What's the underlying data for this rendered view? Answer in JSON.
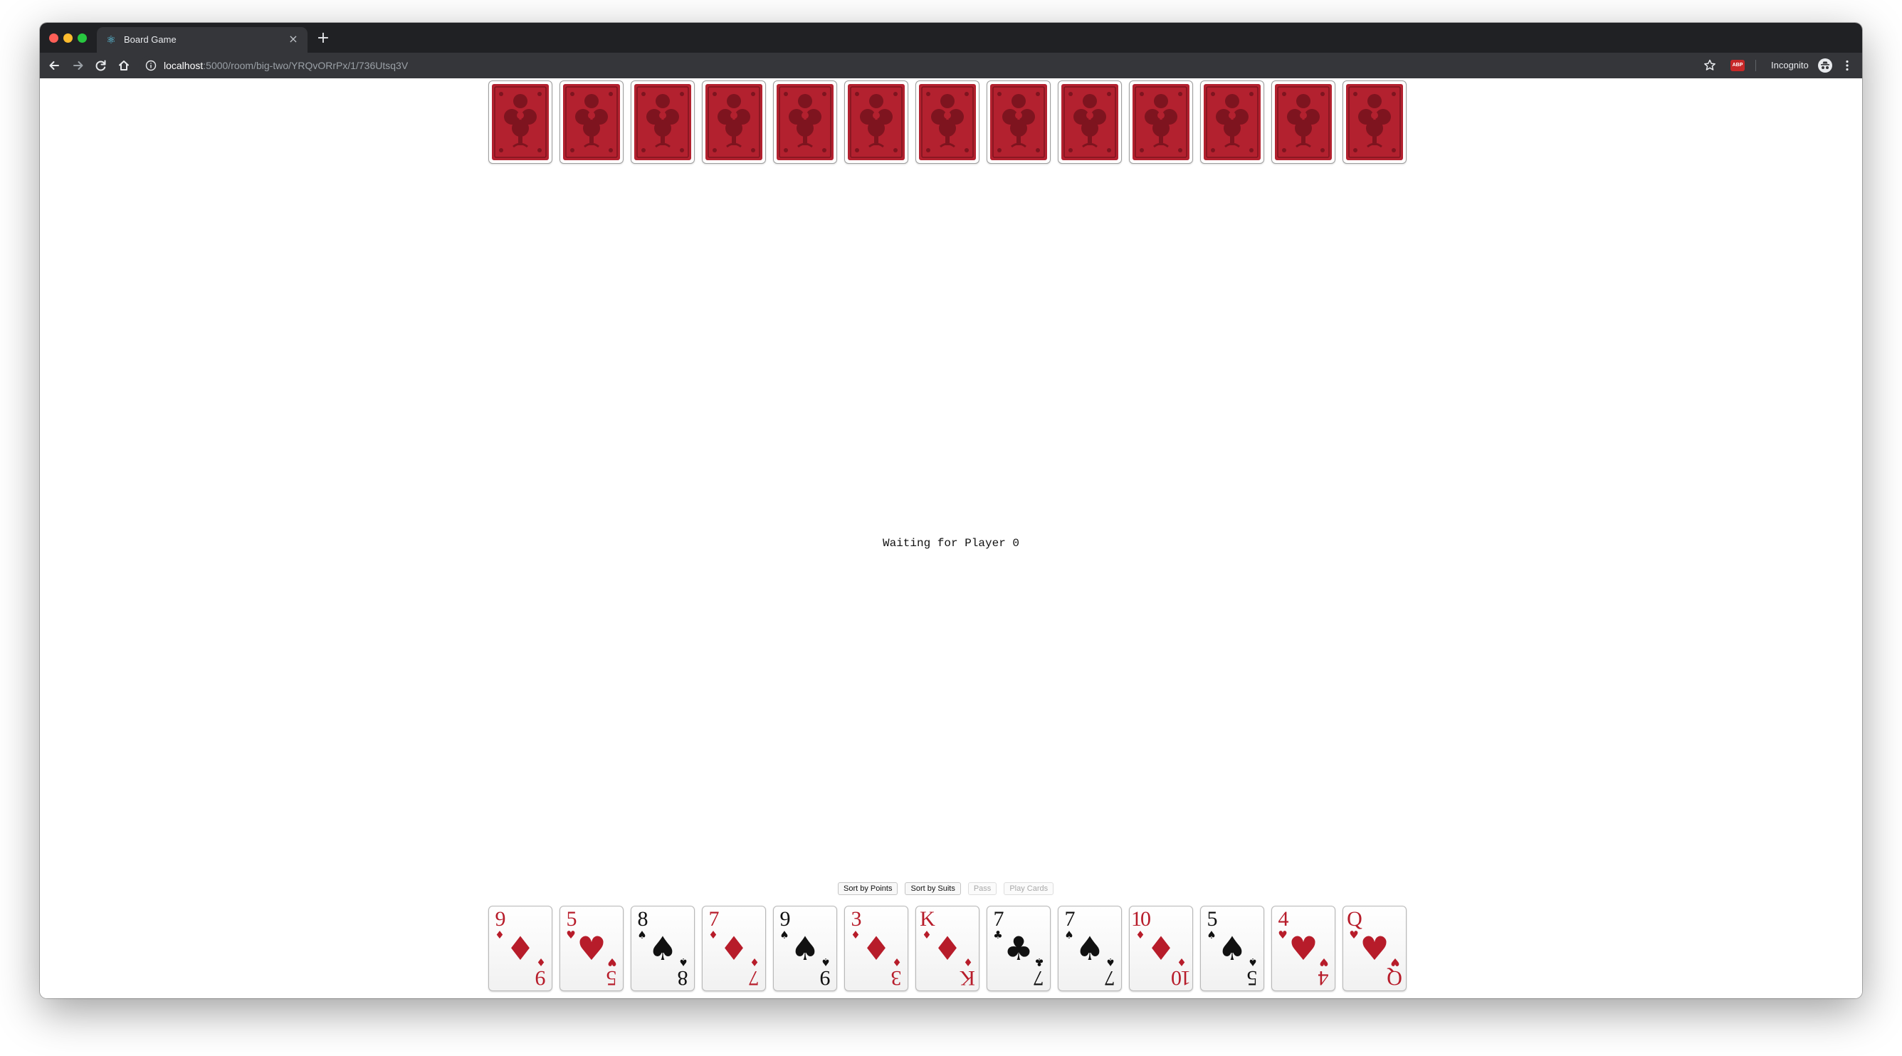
{
  "browser": {
    "tab_title": "Board Game",
    "url_host": "localhost",
    "url_path": ":5000/room/big-two/YRQvORrPx/1/736Utsq3V",
    "profile_label": "Incognito",
    "extension_label": "ABP",
    "icons": [
      "back-icon",
      "forward-icon",
      "reload-icon",
      "home-icon",
      "info-icon",
      "star-icon",
      "incognito-icon",
      "menu-icon",
      "react-icon",
      "close-icon",
      "plus-icon"
    ]
  },
  "opponent": {
    "card_count": 13,
    "back_color": "#b3212f"
  },
  "status": "Waiting for Player 0",
  "controls": {
    "sort_points": "Sort by Points",
    "sort_suits": "Sort by Suits",
    "pass": "Pass",
    "play_cards": "Play Cards"
  },
  "hand": [
    {
      "rank": "9",
      "suit": "♦",
      "color": "red"
    },
    {
      "rank": "5",
      "suit": "♥",
      "color": "red"
    },
    {
      "rank": "8",
      "suit": "♠",
      "color": "black"
    },
    {
      "rank": "7",
      "suit": "♦",
      "color": "red"
    },
    {
      "rank": "9",
      "suit": "♠",
      "color": "black"
    },
    {
      "rank": "3",
      "suit": "♦",
      "color": "red"
    },
    {
      "rank": "K",
      "suit": "♦",
      "color": "red"
    },
    {
      "rank": "7",
      "suit": "♣",
      "color": "black"
    },
    {
      "rank": "7",
      "suit": "♠",
      "color": "black"
    },
    {
      "rank": "10",
      "suit": "♦",
      "color": "red"
    },
    {
      "rank": "5",
      "suit": "♠",
      "color": "black"
    },
    {
      "rank": "4",
      "suit": "♥",
      "color": "red"
    },
    {
      "rank": "Q",
      "suit": "♥",
      "color": "red"
    }
  ]
}
